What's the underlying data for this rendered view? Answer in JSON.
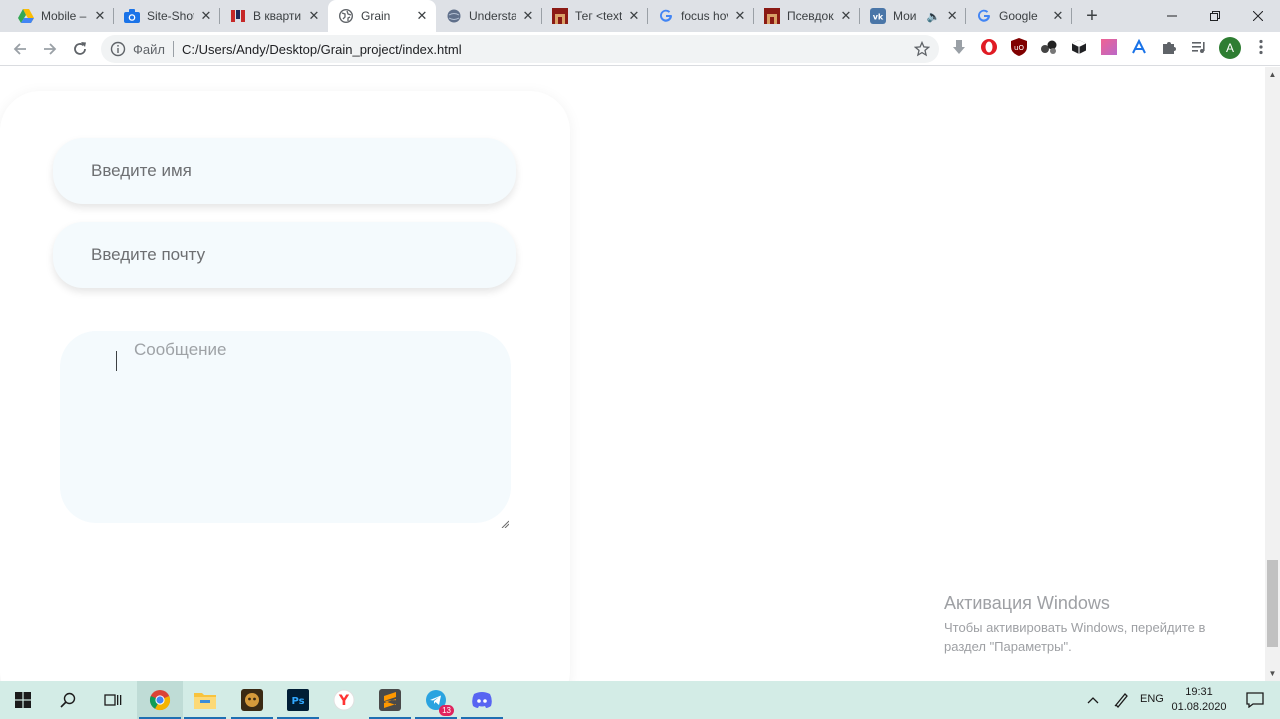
{
  "tabs": [
    {
      "title": "Mobile –",
      "icon": "google-drive-icon"
    },
    {
      "title": "Site-Shot",
      "icon": "camera-icon"
    },
    {
      "title": "В кварти",
      "icon": "site-favicon-icon"
    },
    {
      "title": "Grain",
      "icon": "globe-icon",
      "active": true
    },
    {
      "title": "Understa",
      "icon": "globe-icon"
    },
    {
      "title": "Тег <text",
      "icon": "htmlbook-icon"
    },
    {
      "title": "focus hov",
      "icon": "google-icon"
    },
    {
      "title": "Псевдокл",
      "icon": "htmlbook-icon"
    },
    {
      "title": "Мои",
      "icon": "vk-icon",
      "audio": true
    },
    {
      "title": "Google",
      "icon": "google-icon"
    }
  ],
  "toolbar": {
    "scheme": "Файл",
    "url": "C:/Users/Andy/Desktop/Grain_project/index.html",
    "profile_initial": "A"
  },
  "form": {
    "name_placeholder": "Введите имя",
    "email_placeholder": "Введите почту",
    "message_placeholder": "Сообщение"
  },
  "watermark": {
    "title": "Активация Windows",
    "text": "Чтобы активировать Windows, перейдите в раздел \"Параметры\"."
  },
  "taskbar": {
    "lang": "ENG",
    "time": "19:31",
    "date": "01.08.2020",
    "telegram_badge": "13"
  },
  "colors": {
    "tabstrip": "#dee1e6",
    "field_bg": "#f4fafd",
    "taskbar": "#d3ece6",
    "accent": "#1a73e8"
  }
}
